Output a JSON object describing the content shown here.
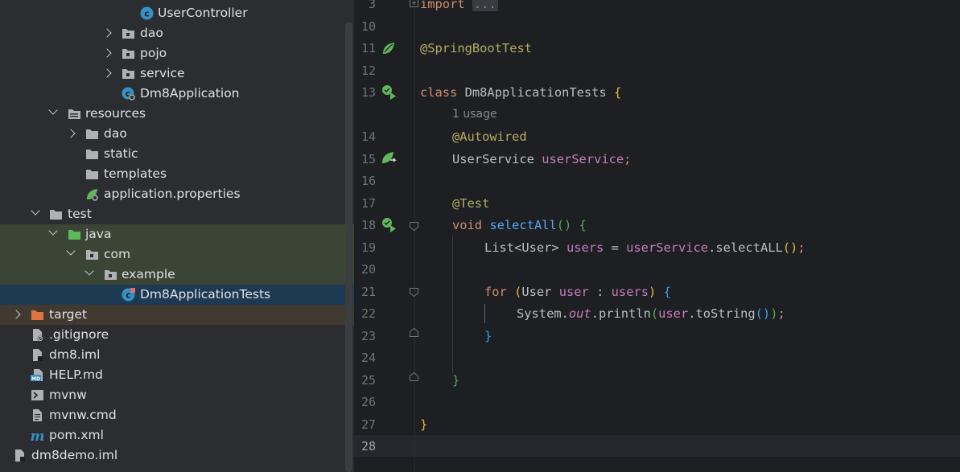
{
  "project_tree": {
    "items": [
      {
        "label": "UserController",
        "icon": "java-class-icon",
        "chevron": "none"
      },
      {
        "label": "dao",
        "icon": "package-folder-icon",
        "chevron": "right"
      },
      {
        "label": "pojo",
        "icon": "package-folder-icon",
        "chevron": "right"
      },
      {
        "label": "service",
        "icon": "package-folder-icon",
        "chevron": "right"
      },
      {
        "label": "Dm8Application",
        "icon": "spring-boot-class-icon",
        "chevron": "none"
      },
      {
        "label": "resources",
        "icon": "resources-folder-icon",
        "chevron": "down"
      },
      {
        "label": "dao",
        "icon": "folder-icon",
        "chevron": "right"
      },
      {
        "label": "static",
        "icon": "folder-icon",
        "chevron": "none"
      },
      {
        "label": "templates",
        "icon": "folder-icon",
        "chevron": "none"
      },
      {
        "label": "application.properties",
        "icon": "spring-properties-icon",
        "chevron": "none"
      },
      {
        "label": "test",
        "icon": "folder-icon",
        "chevron": "down"
      },
      {
        "label": "java",
        "icon": "test-sources-folder-icon",
        "chevron": "down"
      },
      {
        "label": "com",
        "icon": "package-folder-icon",
        "chevron": "down"
      },
      {
        "label": "example",
        "icon": "package-folder-icon",
        "chevron": "down"
      },
      {
        "label": "Dm8ApplicationTests",
        "icon": "test-class-icon",
        "chevron": "none"
      },
      {
        "label": "target",
        "icon": "excluded-folder-icon",
        "chevron": "right"
      },
      {
        "label": ".gitignore",
        "icon": "ignored-file-icon",
        "chevron": "none"
      },
      {
        "label": "dm8.iml",
        "icon": "module-file-icon",
        "chevron": "none"
      },
      {
        "label": "HELP.md",
        "icon": "markdown-file-icon",
        "chevron": "none"
      },
      {
        "label": "mvnw",
        "icon": "shell-script-icon",
        "chevron": "none"
      },
      {
        "label": "mvnw.cmd",
        "icon": "text-file-icon",
        "chevron": "none"
      },
      {
        "label": "pom.xml",
        "icon": "maven-icon",
        "chevron": "none"
      },
      {
        "label": "dm8demo.iml",
        "icon": "module-file-icon",
        "chevron": "none"
      }
    ],
    "selected_item": "Dm8ApplicationTests"
  },
  "editor": {
    "file_name": "Dm8ApplicationTests",
    "current_line": "28",
    "line_numbers": [
      "3",
      "10",
      "11",
      "12",
      "13",
      "14",
      "15",
      "16",
      "17",
      "18",
      "19",
      "20",
      "21",
      "22",
      "23",
      "24",
      "25",
      "26",
      "27",
      "28"
    ],
    "inlay_hint": "1 usage",
    "code": {
      "import_kw": "import",
      "import_fold": "...",
      "spring_boot_test": "@SpringBootTest",
      "class_kw": "class",
      "class_name": "Dm8ApplicationTests",
      "open_brace": "{",
      "autowired": "@Autowired",
      "service_type": "UserService",
      "service_field": "userService",
      "semicolon": ";",
      "test_ann": "@Test",
      "void_kw": "void",
      "method_name": "selectAll",
      "paren_pair": "()",
      "list_type": "List<User>",
      "users_var": "users",
      "assign": "=",
      "field_ref": "userService",
      "dot": ".",
      "select_call": "selectALL",
      "call_paren_pair": "()",
      "for_kw": "for",
      "open_paren": "(",
      "user_type": "User",
      "user_var": "user",
      "colon": ":",
      "users_ref": "users",
      "close_paren": ")",
      "system": "System",
      "out": "out",
      "println": "println",
      "user_ref": "user",
      "to_string": "toString",
      "close_brace": "}"
    }
  },
  "colors": {
    "tree_background": "#2b2d30",
    "editor_background": "#1e1f22",
    "selection": "#1e3a52",
    "test_highlight": "#3b4536",
    "keyword": "#cf8e6d",
    "annotation": "#b3ae60",
    "field": "#c77dbb",
    "method": "#56a8f5"
  }
}
